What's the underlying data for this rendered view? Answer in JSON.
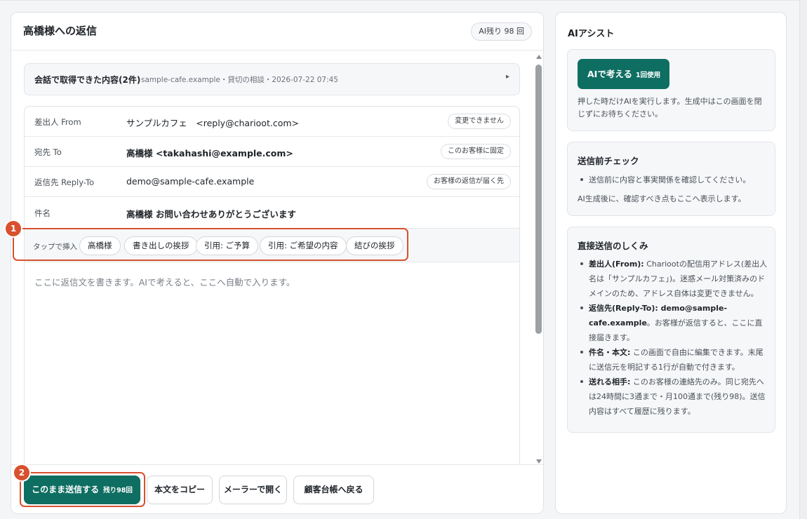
{
  "header": {
    "title": "高橋様への返信",
    "quota": "AI残り 98 回"
  },
  "context": {
    "title": "会話で取得できた内容(2件)",
    "meta": "sample-cafe.example・貸切の相談・2026-07-22 07:45",
    "arrow": "▸"
  },
  "fields": {
    "from": {
      "label": "差出人 From",
      "value": "サンプルカフェ　<reply@charioot.com>",
      "badge": "変更できません"
    },
    "to": {
      "label": "宛先 To",
      "value": "高橋様 <takahashi@example.com>",
      "badge": "このお客様に固定"
    },
    "reply_to": {
      "label": "返信先 Reply-To",
      "value": "demo@sample-cafe.example",
      "badge": "お客様の返信が届く先"
    },
    "subject": {
      "label": "件名",
      "value": "高橋様 お問い合わせありがとうございます"
    }
  },
  "insert": {
    "label": "タップで挿入",
    "chips": [
      "高橋様",
      "書き出しの挨拶",
      "引用: ご予算",
      "引用: ご希望の内容",
      "結びの挨拶"
    ]
  },
  "body": {
    "placeholder": "ここに返信文を書きます。AIで考えると、ここへ自動で入ります。"
  },
  "markers": [
    "1",
    "2"
  ],
  "footer": {
    "send_label": "このまま送信する",
    "send_sub": "残り98回",
    "copy_label": "本文をコピー",
    "mailer_label": "メーラーで開く",
    "back_label": "顧客台帳へ戻る"
  },
  "assist": {
    "title": "AIアシスト",
    "ai_button": "AIで考える",
    "ai_button_sub": "1回使用",
    "ai_note": "押した時だけAIを実行します。生成中はこの画面を閉じずにお待ちください。",
    "check_title": "送信前チェック",
    "check_item": "送信前に内容と事実関係を確認してください。",
    "check_note": "AI生成後に、確認すべき点もここへ表示します。",
    "how_title": "直接送信のしくみ",
    "how_items": [
      {
        "term": "差出人(From):",
        "text": " Chariootの配信用アドレス(差出人名は「サンプルカフェ」)。迷惑メール対策済みのドメインのため、アドレス自体は変更できません。"
      },
      {
        "term": "返信先(Reply-To): demo@sample-cafe.example",
        "text": "。お客様が返信すると、ここに直接届きます。"
      },
      {
        "term": "件名・本文:",
        "text": " この画面で自由に編集できます。末尾に送信元を明記する1行が自動で付きます。"
      },
      {
        "term": "送れる相手:",
        "text": " このお客様の連絡先のみ。同じ宛先へは24時間に3通まで・月100通まで(残り98)。送信内容はすべて履歴に残ります。"
      }
    ]
  },
  "colors": {
    "primary": "#0f6e62",
    "marker": "#d9502e"
  }
}
